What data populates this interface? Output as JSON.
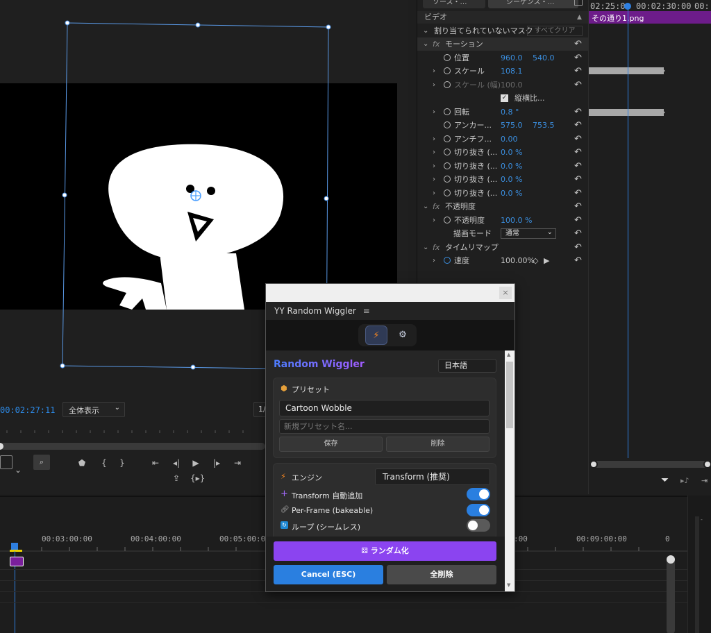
{
  "monitor": {
    "timecode": "00:02:27:11",
    "zoom_label": "全体表示",
    "resolution_partial": "1/"
  },
  "effect_controls": {
    "source_tab": "ソース・…",
    "sequence_tab": "シーケンス・…",
    "section": "ビデオ",
    "unassigned_mask": "割り当てられていないマスク",
    "clear_all": "すべてクリア",
    "rows": [
      {
        "type": "group",
        "label": "モーション",
        "fx": true
      },
      {
        "type": "prop",
        "label": "位置",
        "v1": "960.0",
        "v2": "540.0",
        "watch": true
      },
      {
        "type": "prop",
        "label": "スケール",
        "v1": "108.1",
        "chev": true,
        "watch": true
      },
      {
        "type": "prop",
        "label": "スケール (幅)",
        "v1": "100.0",
        "chev": true,
        "watch": true,
        "dim": true
      },
      {
        "type": "checkbox",
        "label": "縦横比..."
      },
      {
        "type": "prop",
        "label": "回転",
        "v1": "0.8 °",
        "chev": true,
        "watch": true
      },
      {
        "type": "prop",
        "label": "アンカー...",
        "v1": "575.0",
        "v2": "753.5",
        "watch": true
      },
      {
        "type": "prop",
        "label": "アンチフ...",
        "v1": "0.00",
        "chev": true,
        "watch": true
      },
      {
        "type": "prop",
        "label": "切り抜き (...",
        "v1": "0.0 %",
        "chev": true,
        "watch": true
      },
      {
        "type": "prop",
        "label": "切り抜き (...",
        "v1": "0.0 %",
        "chev": true,
        "watch": true
      },
      {
        "type": "prop",
        "label": "切り抜き (...",
        "v1": "0.0 %",
        "chev": true,
        "watch": true
      },
      {
        "type": "prop",
        "label": "切り抜き (...",
        "v1": "0.0 %",
        "chev": true,
        "watch": true
      },
      {
        "type": "group",
        "label": "不透明度",
        "fx": true
      },
      {
        "type": "prop",
        "label": "不透明度",
        "v1": "100.0 %",
        "chev": true,
        "watch": true
      },
      {
        "type": "select",
        "label": "描画モード",
        "v1": "通常"
      },
      {
        "type": "group",
        "label": "タイムリマップ",
        "fx": true
      },
      {
        "type": "prop",
        "label": "速度",
        "v1": "100.00%",
        "chev": true,
        "watch": true
      }
    ],
    "timeline": {
      "tc_left": "02:25:0",
      "tc_right": "00:02:30:00",
      "tc_far": "00:",
      "clip_name": "その通り1.png"
    }
  },
  "timeline": {
    "ruler": [
      "00:03:00:00",
      "00:04:00:00",
      "00:05:00:00",
      ":00",
      "00:09:00:00",
      "0"
    ]
  },
  "wiggler": {
    "title": "YY Random Wiggler",
    "heading": "Random Wiggler",
    "language": "日本語",
    "preset_title": "プリセット",
    "preset_value": "Cartoon Wobble",
    "preset_placeholder": "新規プリセット名...",
    "save_label": "保存",
    "delete_label": "削除",
    "engine_label": "エンジン",
    "engine_value": "Transform (推奨)",
    "opt_transform": "Transform 自動追加",
    "opt_perframe": "Per-Frame (bakeable)",
    "opt_loop": "ループ (シームレス)",
    "randomize_label": "ランダム化",
    "cancel_label": "Cancel (ESC)",
    "clear_label": "全削除",
    "toggles": {
      "transform": true,
      "perframe": true,
      "loop": false
    },
    "colors": {
      "accent_purple": "#8b44f0",
      "accent_blue": "#2a7fe0"
    }
  }
}
